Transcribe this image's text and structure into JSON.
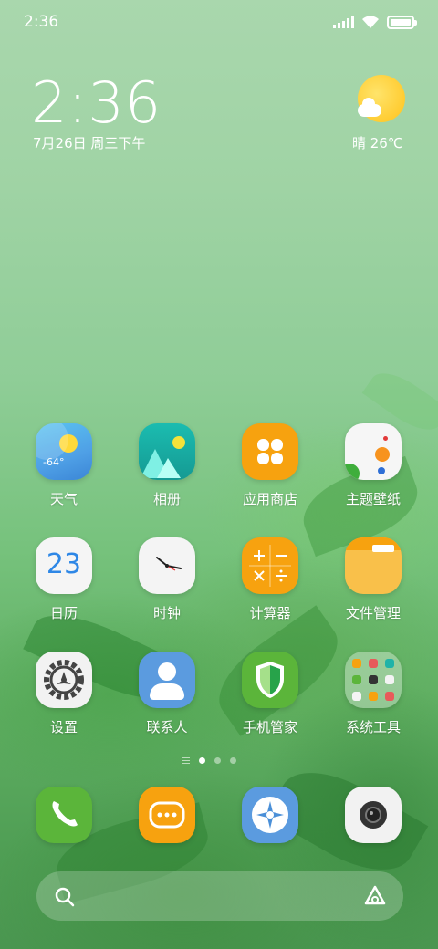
{
  "status_bar": {
    "time": "2:36",
    "icons": [
      "signal-icon",
      "wifi-icon",
      "battery-icon"
    ]
  },
  "clock_widget": {
    "time": "2:36",
    "date": "7月26日 周三下午"
  },
  "weather_widget": {
    "text": "晴 26℃",
    "icon": "sunny-cloud-icon"
  },
  "apps": [
    {
      "label": "天气",
      "icon": "weather-icon",
      "value": "-64°"
    },
    {
      "label": "相册",
      "icon": "gallery-icon"
    },
    {
      "label": "应用商店",
      "icon": "app-store-icon"
    },
    {
      "label": "主题壁纸",
      "icon": "themes-icon"
    },
    {
      "label": "日历",
      "icon": "calendar-icon",
      "value": "23"
    },
    {
      "label": "时钟",
      "icon": "clock-icon"
    },
    {
      "label": "计算器",
      "icon": "calculator-icon"
    },
    {
      "label": "文件管理",
      "icon": "file-manager-icon"
    },
    {
      "label": "设置",
      "icon": "settings-icon"
    },
    {
      "label": "联系人",
      "icon": "contacts-icon"
    },
    {
      "label": "手机管家",
      "icon": "security-icon"
    },
    {
      "label": "系统工具",
      "icon": "folder-icon"
    }
  ],
  "page_indicator": {
    "pages": 3,
    "active": 1
  },
  "dock": [
    {
      "icon": "phone-icon"
    },
    {
      "icon": "messages-icon"
    },
    {
      "icon": "browser-icon"
    },
    {
      "icon": "camera-icon"
    }
  ],
  "search_bar": {
    "search_icon": "search-icon",
    "assistant_icon": "assistant-icon"
  },
  "colors": {
    "green_bg": "#7cc482",
    "orange": "#f7a20f",
    "teal": "#1fb3a8",
    "blue": "#5b9bdf",
    "green_app": "#5bb53a",
    "white_app": "#f2f2f2"
  }
}
